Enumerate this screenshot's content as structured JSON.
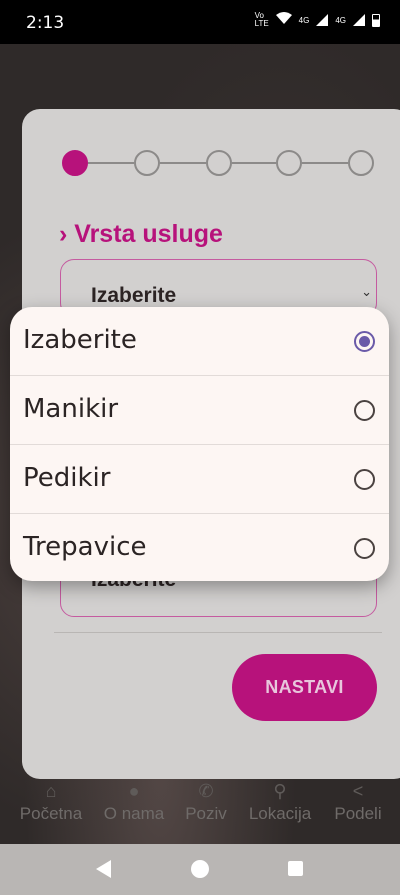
{
  "status_bar": {
    "time": "2:13",
    "network_a": "Vo LTE",
    "net_b": "4G",
    "net_c": "4G"
  },
  "form": {
    "section_title": "› Vrsta usluge",
    "select_1_value": "Izaberite",
    "select_2_value": "Izaberite",
    "next_button": "NASTAVI"
  },
  "stepper": {
    "total_steps": 5,
    "current_step": 1
  },
  "dialog": {
    "options": [
      {
        "label": "Izaberite",
        "selected": true
      },
      {
        "label": "Manikir",
        "selected": false
      },
      {
        "label": "Pedikir",
        "selected": false
      },
      {
        "label": "Trepavice",
        "selected": false
      }
    ]
  },
  "bottom_nav": [
    {
      "label": "Početna",
      "icon": "home-icon"
    },
    {
      "label": "O nama",
      "icon": "person-icon"
    },
    {
      "label": "Poziv",
      "icon": "phone-icon"
    },
    {
      "label": "Lokacija",
      "icon": "location-pin-icon"
    },
    {
      "label": "Podeli",
      "icon": "share-icon"
    }
  ],
  "colors": {
    "accent": "#b7127b",
    "radio_selected": "#6a5aa8"
  }
}
